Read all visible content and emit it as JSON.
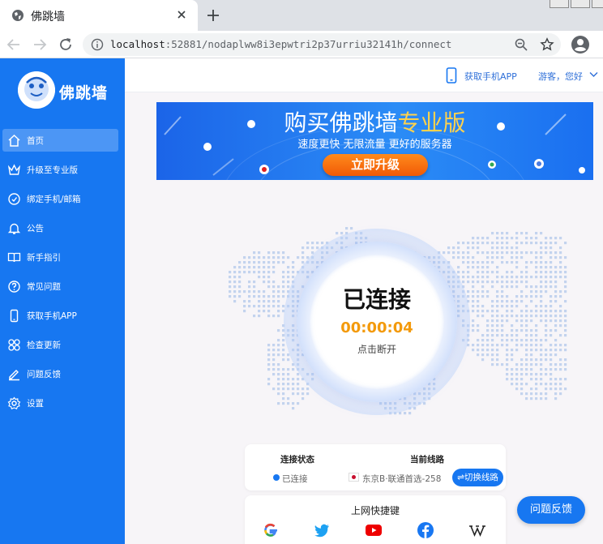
{
  "browser": {
    "tab_title": "佛跳墙",
    "url_host": "localhost",
    "url_rest": ":52881/nodaplww8i3epwtri2p37urriu32141h/connect"
  },
  "app": {
    "brand": "佛跳墙",
    "header": {
      "get_app": "获取手机APP",
      "user_greeting": "游客，您好"
    },
    "menu": [
      {
        "label": "首页",
        "icon": "home-icon",
        "active": true
      },
      {
        "label": "升级至专业版",
        "icon": "crown-icon",
        "active": false
      },
      {
        "label": "绑定手机/邮箱",
        "icon": "bind-icon",
        "active": false
      },
      {
        "label": "公告",
        "icon": "bell-icon",
        "active": false
      },
      {
        "label": "新手指引",
        "icon": "book-icon",
        "active": false
      },
      {
        "label": "常见问题",
        "icon": "question-icon",
        "active": false
      },
      {
        "label": "获取手机APP",
        "icon": "phone-icon",
        "active": false
      },
      {
        "label": "检查更新",
        "icon": "grid-icon",
        "active": false
      },
      {
        "label": "问题反馈",
        "icon": "edit-icon",
        "active": false
      },
      {
        "label": "设置",
        "icon": "gear-icon",
        "active": false
      }
    ],
    "banner": {
      "title_main": "购买佛跳墙",
      "title_accent": "专业版",
      "subtitle": "速度更快 无限流量 更好的服务器",
      "button": "立即升级"
    },
    "connection": {
      "status": "已连接",
      "timer": "00:00:04",
      "action": "点击断开"
    },
    "info": {
      "status_label": "连接状态",
      "status_value": "已连接",
      "line_label": "当前线路",
      "line_value": "东京B·联通首选-258",
      "switch_button": "⇌切换线路"
    },
    "shortcuts": {
      "title": "上网快捷键",
      "items": [
        "google-icon",
        "twitter-icon",
        "youtube-icon",
        "facebook-icon",
        "wikipedia-icon"
      ]
    },
    "feedback_button": "问题反馈",
    "colors": {
      "sidebar": "#1777f1",
      "timer": "#f39a0c",
      "banner_accent": "#ffd24d"
    }
  }
}
